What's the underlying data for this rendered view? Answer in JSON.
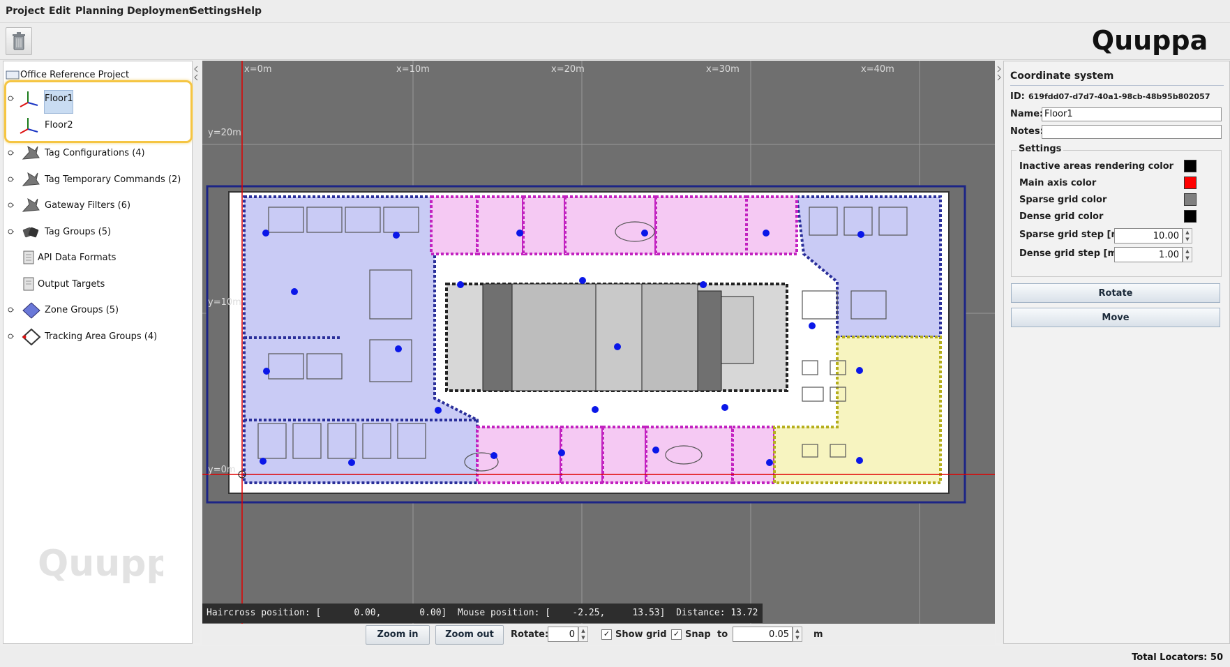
{
  "menu": [
    "Project",
    "Edit",
    "Planning",
    "Deployment",
    "Settings",
    "Help"
  ],
  "brand": {
    "logo_text": "Quuppa",
    "color": "#111111"
  },
  "tree": {
    "root": "Office Reference Project",
    "floors": [
      "Floor1",
      "Floor2"
    ],
    "items": [
      {
        "label": "Tag Configurations (4)",
        "icon": "tag-config-icon"
      },
      {
        "label": "Tag Temporary Commands (2)",
        "icon": "tag-command-icon"
      },
      {
        "label": "Gateway Filters (6)",
        "icon": "gateway-filter-icon"
      },
      {
        "label": "Tag Groups (5)",
        "icon": "tag-groups-icon"
      },
      {
        "label": "API Data Formats",
        "icon": "api-format-icon"
      },
      {
        "label": "Output Targets",
        "icon": "output-target-icon"
      },
      {
        "label": "Zone Groups (5)",
        "icon": "zone-groups-icon"
      },
      {
        "label": "Tracking Area Groups (4)",
        "icon": "tracking-area-icon"
      }
    ]
  },
  "canvas": {
    "x_labels": [
      "x=0m",
      "x=10m",
      "x=20m",
      "x=30m",
      "x=40m"
    ],
    "y_labels": [
      "y=20m",
      "y=10m",
      "y=0m"
    ],
    "status": "Haircross position: [      0.00,       0.00]  Mouse position: [    -2.25,     13.53]  Distance: 13.72",
    "zone_colors": {
      "blue": "#c9cbf5",
      "pink": "#f5c9f3",
      "yellow": "#f7f4c0",
      "corridor": "#ffffff"
    }
  },
  "bottom": {
    "zoom_in": "Zoom in",
    "zoom_out": "Zoom out",
    "rotate_label": "Rotate:",
    "rotate_value": "0",
    "show_grid": "Show grid",
    "snap": "Snap",
    "to": "to",
    "snap_value": "0.05",
    "unit": "m"
  },
  "coord": {
    "title": "Coordinate system",
    "id_label": "ID:",
    "id_value": "619fdd07-d7d7-40a1-98cb-48b95b802057",
    "name_label": "Name:",
    "name_value": "Floor1",
    "notes_label": "Notes:",
    "notes_value": "",
    "settings_label": "Settings",
    "inactive_label": "Inactive areas rendering color",
    "inactive_color": "#000000",
    "main_axis_label": "Main axis color",
    "main_axis_color": "#ff0000",
    "sparse_color_label": "Sparse grid color",
    "sparse_color": "#808080",
    "dense_color_label": "Dense grid color",
    "dense_color": "#000000",
    "sparse_step_label": "Sparse grid step  [m]",
    "sparse_step": "10.00",
    "dense_step_label": "Dense grid step  [m]",
    "dense_step": "1.00",
    "rotate": "Rotate",
    "move": "Move"
  },
  "footer": {
    "total_locators": "Total Locators: 50"
  }
}
